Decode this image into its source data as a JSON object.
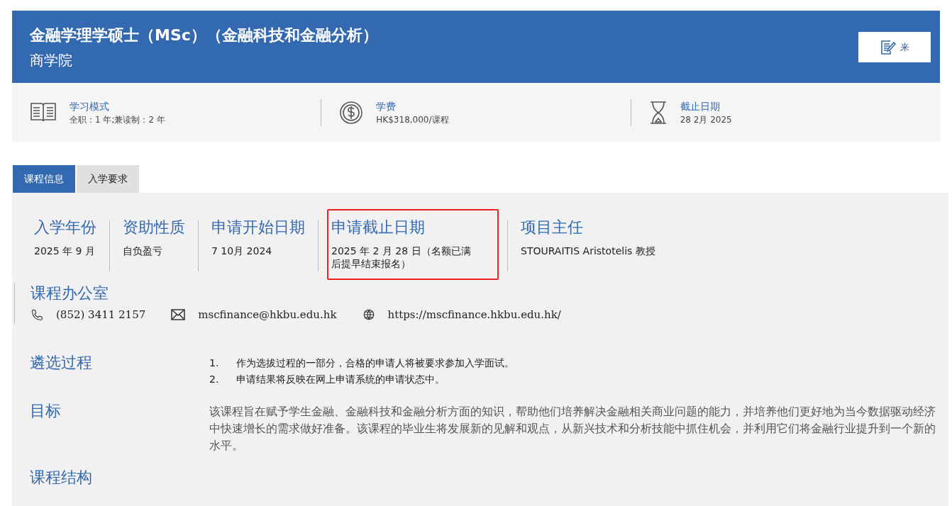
{
  "header": {
    "title": "金融学理学硕士（MSc）（金融科技和金融分析）",
    "subtitle": "商学院",
    "button": "来"
  },
  "summary": [
    {
      "kind": "book",
      "label": "学习模式",
      "value": "全职：1 年;兼读制：2 年"
    },
    {
      "kind": "coin",
      "label": "学费",
      "value": "HK$318,000/课程"
    },
    {
      "kind": "hourglass",
      "label": "截止日期",
      "value": "28 2月 2025"
    }
  ],
  "tabs": [
    {
      "label": "课程信息",
      "selected": true
    },
    {
      "label": "入学要求",
      "selected": false
    }
  ],
  "facts": [
    {
      "label": "入学年份",
      "value": "2025 年 9 月",
      "highlighted": false
    },
    {
      "label": "资助性质",
      "value": "自负盈亏",
      "highlighted": false
    },
    {
      "label": "申请开始日期",
      "value": "7 10月 2024",
      "highlighted": false
    },
    {
      "label": "申请截止日期",
      "value": "2025 年 2 月 28 日（名额已满后提早结束报名）",
      "highlighted": true
    },
    {
      "label": "项目主任",
      "value": "STOURAITIS Aristotelis 教授",
      "highlighted": false
    }
  ],
  "office": {
    "title": "课程办公室",
    "contacts": [
      {
        "kind": "phone",
        "text": "(852) 3411 2157"
      },
      {
        "kind": "email",
        "text": "mscfinance@hkbu.edu.hk"
      },
      {
        "kind": "web",
        "text": "https://mscfinance.hkbu.edu.hk/"
      }
    ]
  },
  "sections": [
    {
      "title": "遴选过程",
      "items": [
        {
          "number": "1.",
          "text": "作为选拔过程的一部分，合格的申请人将被要求参加入学面试。"
        },
        {
          "number": "2.",
          "text": "申请结果将反映在网上申请系统的申请状态中。"
        }
      ]
    },
    {
      "title": "目标",
      "text": "该课程旨在赋予学生金融、金融科技和金融分析方面的知识，帮助他们培养解决金融相关商业问题的能力，并培养他们更好地为当今数据驱动经济中快速增长的需求做好准备。该课程的毕业生将发展新的见解和观点，从新兴技术和分析技能中抓住机会，并利用它们将金融行业提升到一个新的水平。"
    },
    {
      "title": "课程结构"
    }
  ]
}
